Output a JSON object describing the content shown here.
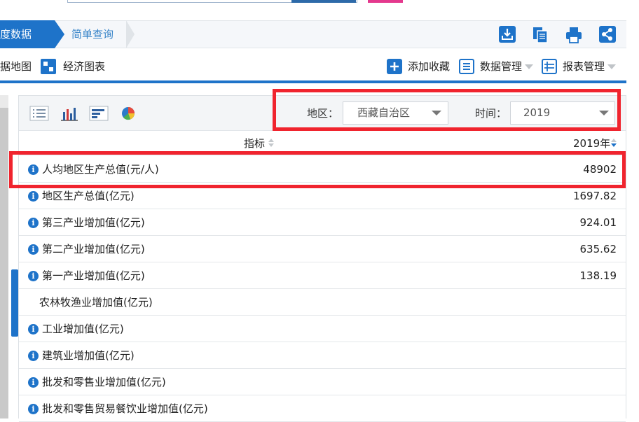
{
  "breadcrumb": {
    "items": [
      "度数据",
      "简单查询"
    ]
  },
  "toolbar": {
    "left": [
      "据地图",
      "经济图表"
    ],
    "right": [
      "添加收藏",
      "数据管理",
      "报表管理"
    ]
  },
  "filters": {
    "region_label": "地区：",
    "region_value": "西藏自治区",
    "time_label": "时间：",
    "time_value": "2019"
  },
  "table": {
    "headers": [
      "指标",
      "2019年"
    ],
    "rows": [
      {
        "label": "人均地区生产总值(元/人)",
        "value": "48902",
        "info": true
      },
      {
        "label": "地区生产总值(亿元)",
        "value": "1697.82",
        "info": true
      },
      {
        "label": "第三产业增加值(亿元)",
        "value": "924.01",
        "info": true
      },
      {
        "label": "第二产业增加值(亿元)",
        "value": "635.62",
        "info": true
      },
      {
        "label": "第一产业增加值(亿元)",
        "value": "138.19",
        "info": true
      },
      {
        "label": "农林牧渔业增加值(亿元)",
        "value": "",
        "info": false
      },
      {
        "label": "工业增加值(亿元)",
        "value": "",
        "info": true
      },
      {
        "label": "建筑业增加值(亿元)",
        "value": "",
        "info": true
      },
      {
        "label": "批发和零售业增加值(亿元)",
        "value": "",
        "info": true
      },
      {
        "label": "批发和零售贸易餐饮业增加值(亿元)",
        "value": "",
        "info": true
      }
    ]
  },
  "colors": {
    "accent": "#1e73c9",
    "highlight": "#f0242e"
  }
}
